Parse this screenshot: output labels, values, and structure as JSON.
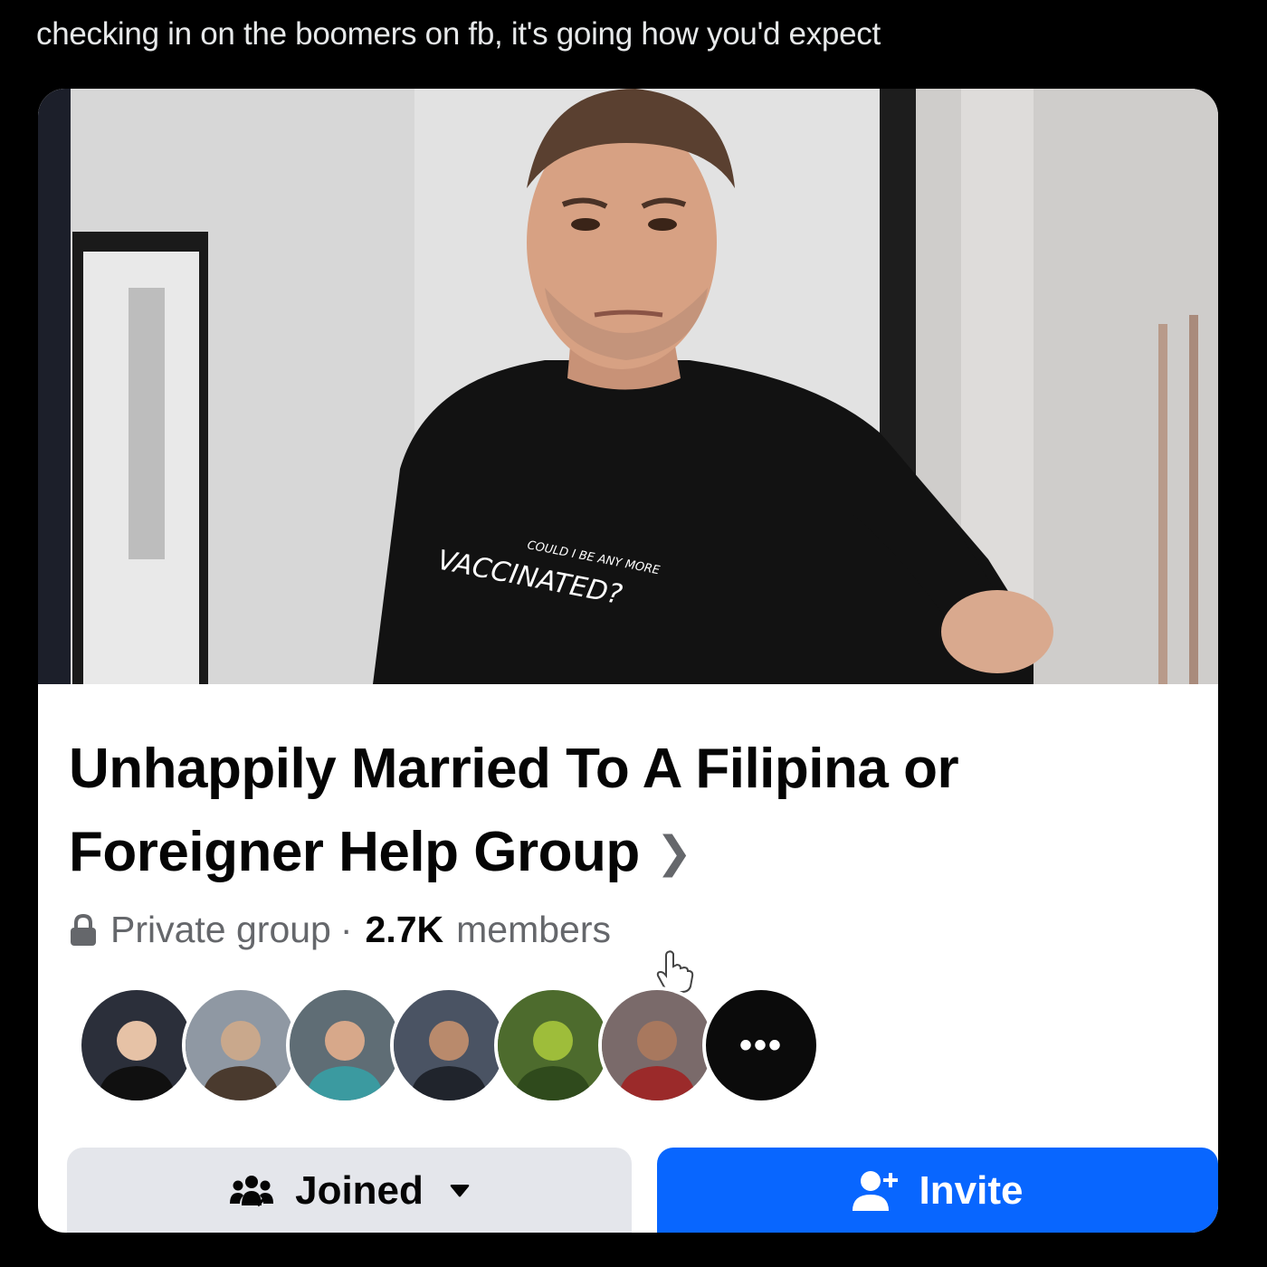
{
  "post": {
    "caption": "checking in on the boomers on fb, it's going how you'd expect"
  },
  "group": {
    "cover": {
      "shirt_text_line1": "COULD I BE ANY MORE",
      "shirt_text_line2": "VACCINATED?"
    },
    "name": "Unhappily Married To A Filipina or Foreigner Help Group",
    "chevron_icon": "chevron-right-icon",
    "privacy_icon": "lock-icon",
    "privacy": "Private group",
    "separator": "·",
    "member_count": "2.7K",
    "member_label": "members",
    "member_avatars": [
      {
        "name": "member-avatar-1",
        "bg": "#2b2f3a",
        "skin": "#e6c2a6",
        "shirt": "#101010"
      },
      {
        "name": "member-avatar-2",
        "bg": "#8f98a3",
        "skin": "#c9a88c",
        "shirt": "#4a3a2e"
      },
      {
        "name": "member-avatar-3",
        "bg": "#5f6d75",
        "skin": "#d7a88a",
        "shirt": "#3b9aa0"
      },
      {
        "name": "member-avatar-4",
        "bg": "#4a5363",
        "skin": "#b98a6c",
        "shirt": "#20242c"
      },
      {
        "name": "member-avatar-5",
        "bg": "#4d6b2d",
        "skin": "#9ebd3a",
        "shirt": "#2f4a1c"
      },
      {
        "name": "member-avatar-6",
        "bg": "#7a6a6a",
        "skin": "#a8785e",
        "shirt": "#9b2a2a"
      }
    ],
    "more_members_label": "•••",
    "more_members_icon": "more-icon",
    "joined_icon": "group-icon",
    "joined_label": "Joined",
    "joined_caret_icon": "caret-down-icon",
    "invite_icon": "add-person-icon",
    "invite_label": "Invite"
  },
  "colors": {
    "page_bg": "#000000",
    "caption": "#e7e9ea",
    "card_bg": "#ffffff",
    "title": "#050505",
    "secondary_text": "#65676b",
    "joined_button_bg": "#e4e6eb",
    "invite_button_bg": "#0866ff"
  }
}
